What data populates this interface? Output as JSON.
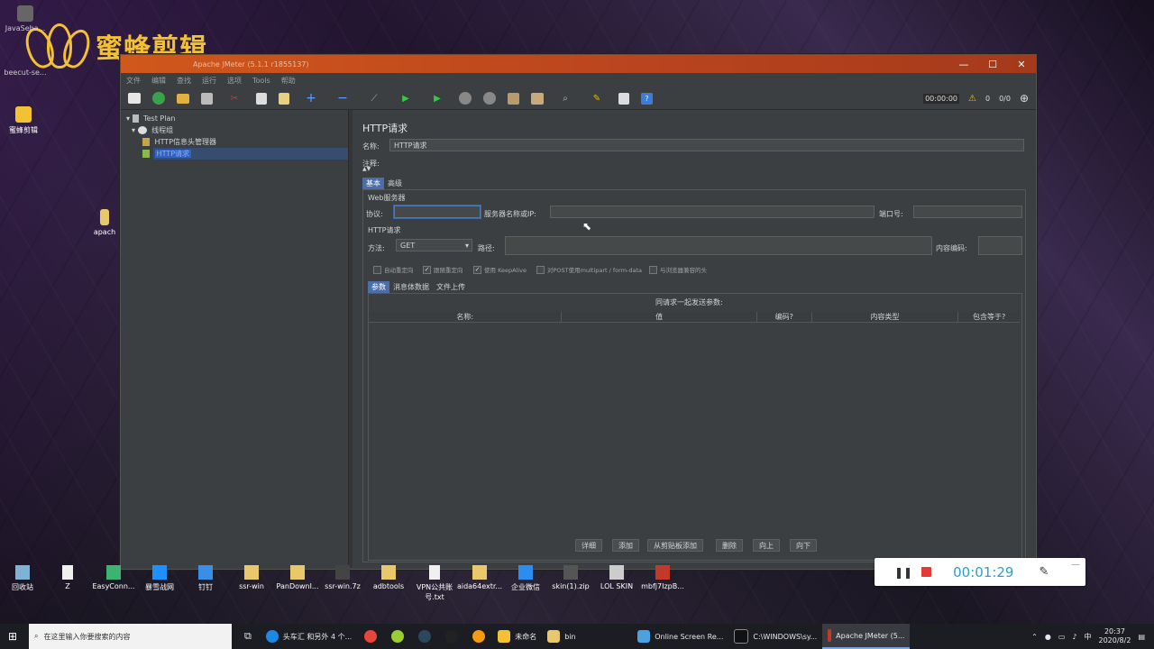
{
  "desktop": {
    "brand_text": "蜜蜂剪辑",
    "icons_left": [
      {
        "label": "JavaSeba..."
      },
      {
        "label": "beecut-se..."
      },
      {
        "label": "蜜蜂剪辑"
      },
      {
        "label": "apach"
      }
    ],
    "dock": [
      {
        "label": "回收站"
      },
      {
        "label": "Z"
      },
      {
        "label": "EasyConn..."
      },
      {
        "label": "暴雪战网"
      },
      {
        "label": "钉钉"
      },
      {
        "label": "ssr-win"
      },
      {
        "label": "PanDownl..."
      },
      {
        "label": "ssr-win.7z"
      },
      {
        "label": "adbtools"
      },
      {
        "label": "VPN公共账号.txt"
      },
      {
        "label": "aida64extr..."
      },
      {
        "label": "企业微信"
      },
      {
        "label": "skin(1).zip"
      },
      {
        "label": "LOL SKIN"
      },
      {
        "label": "mbfj7IzpB..."
      }
    ]
  },
  "window": {
    "title": "Apache JMeter (5.1.1 r1855137)",
    "controls": [
      "—",
      "☐",
      "✕"
    ],
    "menu": [
      "文件",
      "编辑",
      "查找",
      "运行",
      "选项",
      "Tools",
      "帮助"
    ],
    "toolbar_right": {
      "timer": "00:00:00",
      "warnings": "0",
      "threads": "0/0"
    }
  },
  "tree": {
    "items": [
      {
        "label": "Test Plan",
        "level": 0
      },
      {
        "label": "线程组",
        "level": 1
      },
      {
        "label": "HTTP信息头管理器",
        "level": 2
      },
      {
        "label": "HTTP请求",
        "level": 2,
        "selected": true
      }
    ]
  },
  "http": {
    "title": "HTTP请求",
    "name_label": "名称:",
    "name_value": "HTTP请求",
    "comment_label": "注释:",
    "tabs": [
      "基本",
      "高级"
    ],
    "web_server_label": "Web服务器",
    "protocol_label": "协议:",
    "server_label": "服务器名称或IP:",
    "port_label": "端口号:",
    "request_label": "HTTP请求",
    "method_label": "方法:",
    "method_value": "GET",
    "path_label": "路径:",
    "encoding_label": "内容编码:",
    "checkboxes": [
      {
        "label": "自动重定向",
        "checked": false
      },
      {
        "label": "跟随重定向",
        "checked": true
      },
      {
        "label": "使用 KeepAlive",
        "checked": true
      },
      {
        "label": "对POST使用multipart / form-data",
        "checked": false
      },
      {
        "label": "与浏览器兼容的头",
        "checked": false
      }
    ],
    "sub_tabs": [
      "参数",
      "消息体数据",
      "文件上传"
    ],
    "params_caption": "同请求一起发送参数:",
    "columns": [
      "名称:",
      "值",
      "编码?",
      "内容类型",
      "包含等于?"
    ],
    "buttons": [
      "详细",
      "添加",
      "从剪贴板添加",
      "删除",
      "向上",
      "向下"
    ]
  },
  "recorder": {
    "time": "00:01:29"
  },
  "taskbar": {
    "search_placeholder": "在这里输入你要搜索的内容",
    "items": [
      {
        "label": "头车汇 和另外 4 个..."
      },
      {
        "label": "未命名"
      },
      {
        "label": "bin"
      },
      {
        "label": "Online Screen Re..."
      },
      {
        "label": "C:\\WINDOWS\\sy..."
      },
      {
        "label": "Apache JMeter (5..."
      }
    ],
    "ime": "中",
    "time": "20:37",
    "date": "2020/8/2"
  }
}
